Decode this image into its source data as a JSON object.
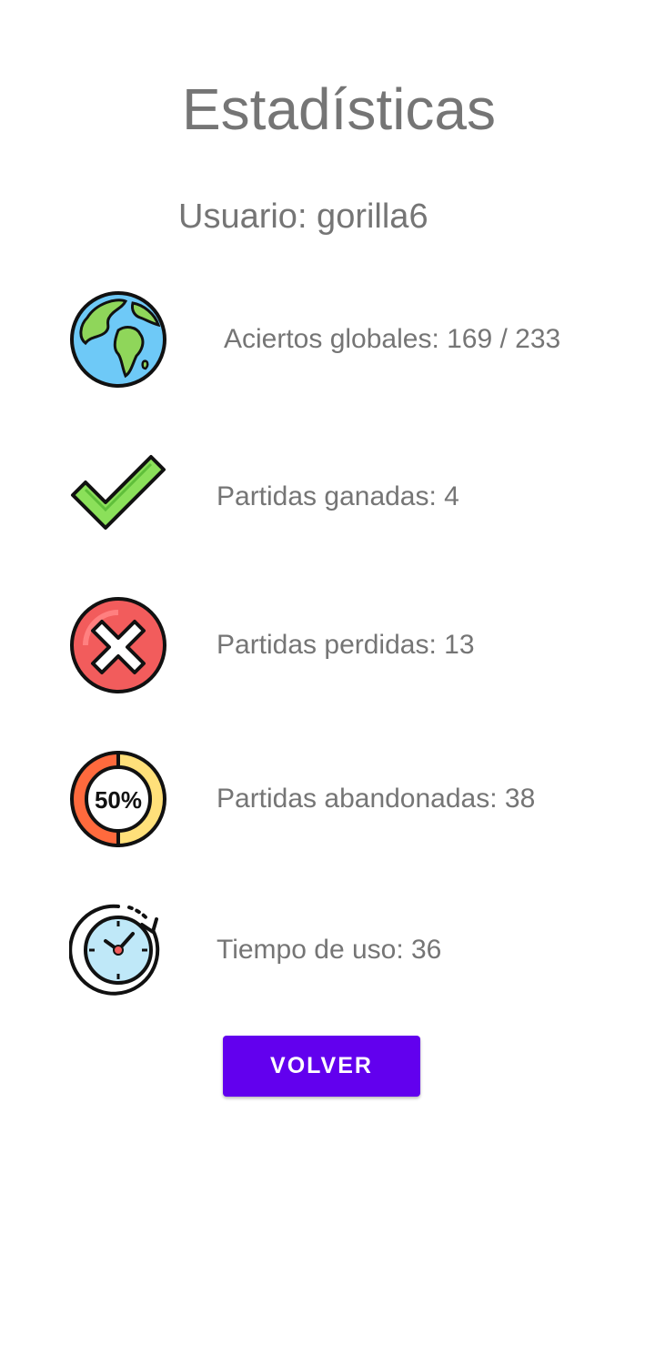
{
  "header": {
    "title": "Estadísticas",
    "user_label": "Usuario: gorilla6"
  },
  "stats": [
    {
      "icon": "globe-icon",
      "label": "Aciertos globales: 169 / 233"
    },
    {
      "icon": "checkmark-icon",
      "label": "Partidas ganadas: 4"
    },
    {
      "icon": "cross-circle-icon",
      "label": "Partidas perdidas: 13"
    },
    {
      "icon": "fifty-percent-icon",
      "label": "Partidas abandonadas: 38",
      "icon_text": "50%"
    },
    {
      "icon": "clock-icon",
      "label": "Tiempo de uso: 36"
    }
  ],
  "actions": {
    "back_label": "VOLVER"
  },
  "colors": {
    "primary": "#6200ee",
    "text": "#757575",
    "background": "#ffffff"
  }
}
